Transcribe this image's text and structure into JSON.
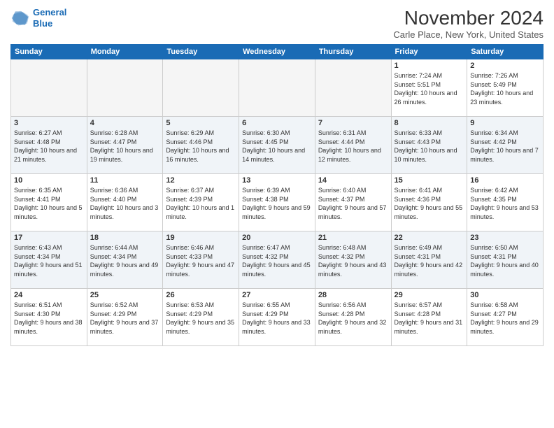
{
  "header": {
    "logo_line1": "General",
    "logo_line2": "Blue",
    "month_title": "November 2024",
    "location": "Carle Place, New York, United States"
  },
  "days_of_week": [
    "Sunday",
    "Monday",
    "Tuesday",
    "Wednesday",
    "Thursday",
    "Friday",
    "Saturday"
  ],
  "weeks": [
    [
      {
        "day": "",
        "info": ""
      },
      {
        "day": "",
        "info": ""
      },
      {
        "day": "",
        "info": ""
      },
      {
        "day": "",
        "info": ""
      },
      {
        "day": "",
        "info": ""
      },
      {
        "day": "1",
        "info": "Sunrise: 7:24 AM\nSunset: 5:51 PM\nDaylight: 10 hours and 26 minutes."
      },
      {
        "day": "2",
        "info": "Sunrise: 7:26 AM\nSunset: 5:49 PM\nDaylight: 10 hours and 23 minutes."
      }
    ],
    [
      {
        "day": "3",
        "info": "Sunrise: 6:27 AM\nSunset: 4:48 PM\nDaylight: 10 hours and 21 minutes."
      },
      {
        "day": "4",
        "info": "Sunrise: 6:28 AM\nSunset: 4:47 PM\nDaylight: 10 hours and 19 minutes."
      },
      {
        "day": "5",
        "info": "Sunrise: 6:29 AM\nSunset: 4:46 PM\nDaylight: 10 hours and 16 minutes."
      },
      {
        "day": "6",
        "info": "Sunrise: 6:30 AM\nSunset: 4:45 PM\nDaylight: 10 hours and 14 minutes."
      },
      {
        "day": "7",
        "info": "Sunrise: 6:31 AM\nSunset: 4:44 PM\nDaylight: 10 hours and 12 minutes."
      },
      {
        "day": "8",
        "info": "Sunrise: 6:33 AM\nSunset: 4:43 PM\nDaylight: 10 hours and 10 minutes."
      },
      {
        "day": "9",
        "info": "Sunrise: 6:34 AM\nSunset: 4:42 PM\nDaylight: 10 hours and 7 minutes."
      }
    ],
    [
      {
        "day": "10",
        "info": "Sunrise: 6:35 AM\nSunset: 4:41 PM\nDaylight: 10 hours and 5 minutes."
      },
      {
        "day": "11",
        "info": "Sunrise: 6:36 AM\nSunset: 4:40 PM\nDaylight: 10 hours and 3 minutes."
      },
      {
        "day": "12",
        "info": "Sunrise: 6:37 AM\nSunset: 4:39 PM\nDaylight: 10 hours and 1 minute."
      },
      {
        "day": "13",
        "info": "Sunrise: 6:39 AM\nSunset: 4:38 PM\nDaylight: 9 hours and 59 minutes."
      },
      {
        "day": "14",
        "info": "Sunrise: 6:40 AM\nSunset: 4:37 PM\nDaylight: 9 hours and 57 minutes."
      },
      {
        "day": "15",
        "info": "Sunrise: 6:41 AM\nSunset: 4:36 PM\nDaylight: 9 hours and 55 minutes."
      },
      {
        "day": "16",
        "info": "Sunrise: 6:42 AM\nSunset: 4:35 PM\nDaylight: 9 hours and 53 minutes."
      }
    ],
    [
      {
        "day": "17",
        "info": "Sunrise: 6:43 AM\nSunset: 4:34 PM\nDaylight: 9 hours and 51 minutes."
      },
      {
        "day": "18",
        "info": "Sunrise: 6:44 AM\nSunset: 4:34 PM\nDaylight: 9 hours and 49 minutes."
      },
      {
        "day": "19",
        "info": "Sunrise: 6:46 AM\nSunset: 4:33 PM\nDaylight: 9 hours and 47 minutes."
      },
      {
        "day": "20",
        "info": "Sunrise: 6:47 AM\nSunset: 4:32 PM\nDaylight: 9 hours and 45 minutes."
      },
      {
        "day": "21",
        "info": "Sunrise: 6:48 AM\nSunset: 4:32 PM\nDaylight: 9 hours and 43 minutes."
      },
      {
        "day": "22",
        "info": "Sunrise: 6:49 AM\nSunset: 4:31 PM\nDaylight: 9 hours and 42 minutes."
      },
      {
        "day": "23",
        "info": "Sunrise: 6:50 AM\nSunset: 4:31 PM\nDaylight: 9 hours and 40 minutes."
      }
    ],
    [
      {
        "day": "24",
        "info": "Sunrise: 6:51 AM\nSunset: 4:30 PM\nDaylight: 9 hours and 38 minutes."
      },
      {
        "day": "25",
        "info": "Sunrise: 6:52 AM\nSunset: 4:29 PM\nDaylight: 9 hours and 37 minutes."
      },
      {
        "day": "26",
        "info": "Sunrise: 6:53 AM\nSunset: 4:29 PM\nDaylight: 9 hours and 35 minutes."
      },
      {
        "day": "27",
        "info": "Sunrise: 6:55 AM\nSunset: 4:29 PM\nDaylight: 9 hours and 33 minutes."
      },
      {
        "day": "28",
        "info": "Sunrise: 6:56 AM\nSunset: 4:28 PM\nDaylight: 9 hours and 32 minutes."
      },
      {
        "day": "29",
        "info": "Sunrise: 6:57 AM\nSunset: 4:28 PM\nDaylight: 9 hours and 31 minutes."
      },
      {
        "day": "30",
        "info": "Sunrise: 6:58 AM\nSunset: 4:27 PM\nDaylight: 9 hours and 29 minutes."
      }
    ]
  ]
}
